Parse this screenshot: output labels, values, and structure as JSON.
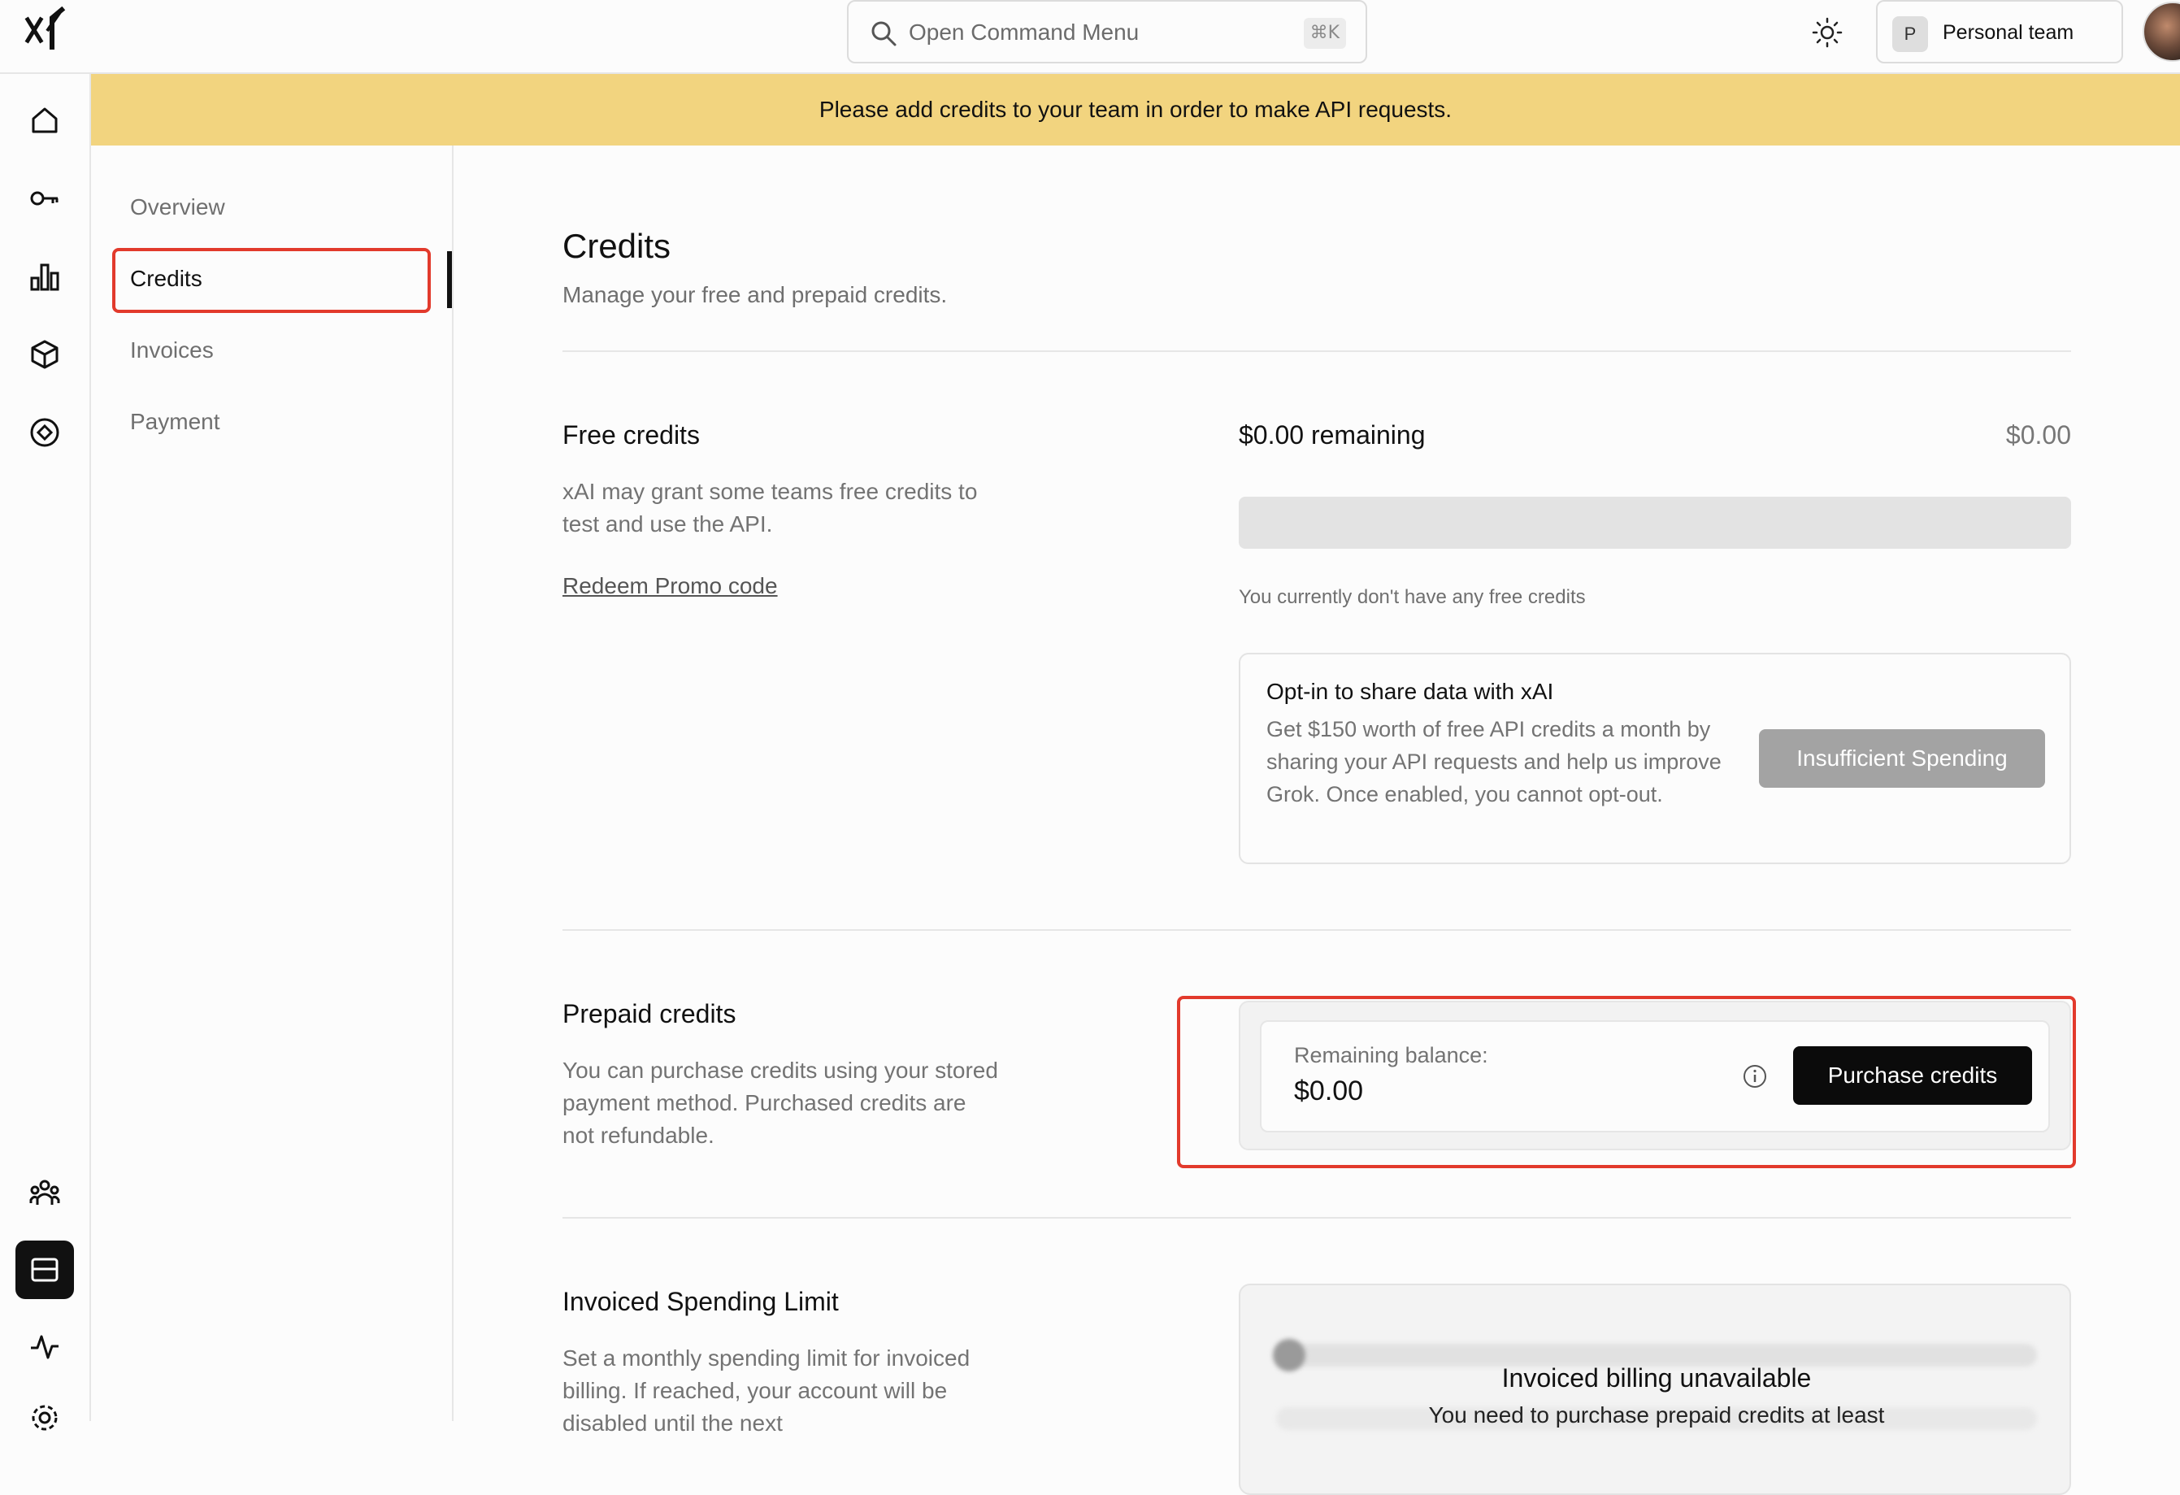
{
  "topbar": {
    "search_placeholder": "Open Command Menu",
    "search_shortcut": "⌘K",
    "team_initial": "P",
    "team_name": "Personal team"
  },
  "banner": {
    "text": "Please add credits to your team in order to make API requests."
  },
  "rail": {
    "items": [
      "home-icon",
      "key-icon",
      "bar-chart-icon",
      "cube-icon",
      "compass-icon",
      "team-icon",
      "billing-icon",
      "activity-icon",
      "settings-icon"
    ],
    "active": "billing-icon"
  },
  "subnav": {
    "items": [
      {
        "label": "Overview"
      },
      {
        "label": "Credits"
      },
      {
        "label": "Invoices"
      },
      {
        "label": "Payment"
      }
    ],
    "active_index": 1
  },
  "page": {
    "title": "Credits",
    "subtitle": "Manage your free and prepaid credits."
  },
  "free_credits": {
    "title": "Free credits",
    "description": "xAI may grant some teams free credits to test and use the API.",
    "promo_link": "Redeem Promo code",
    "remaining_label": "$0.00 remaining",
    "total": "$0.00",
    "progress_fraction": 0,
    "note": "You currently don't have any free credits"
  },
  "opt_in": {
    "title": "Opt-in to share data with xAI",
    "description": "Get $150 worth of free API credits a month by sharing your API requests and help us improve Grok. Once enabled, you cannot opt-out.",
    "button": "Insufficient Spending"
  },
  "prepaid": {
    "title": "Prepaid credits",
    "description": "You can purchase credits using your stored payment method. Purchased credits are not refundable.",
    "balance_label": "Remaining balance:",
    "balance_value": "$0.00",
    "button": "Purchase credits"
  },
  "invoiced": {
    "title": "Invoiced Spending Limit",
    "description": "Set a monthly spending limit for invoiced billing. If reached, your account will be disabled until the next",
    "overlay_title": "Invoiced billing unavailable",
    "overlay_desc": "You need to purchase prepaid credits at least"
  },
  "colors": {
    "banner": "#f2d47f",
    "highlight": "#e23a2c",
    "primary_button": "#0b0b0b",
    "disabled_button": "#a3a3a3"
  }
}
